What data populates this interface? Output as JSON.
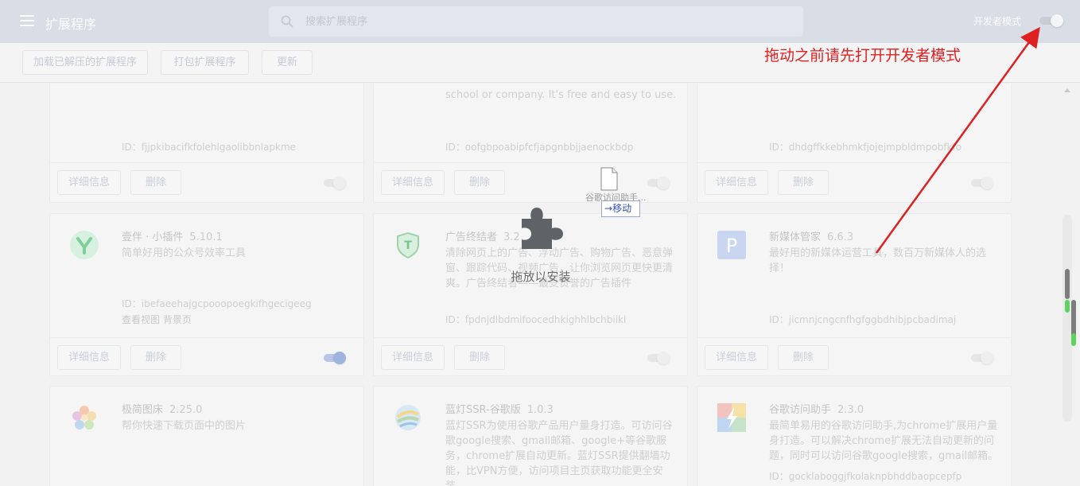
{
  "header": {
    "title": "扩展程序",
    "search_placeholder": "搜索扩展程序",
    "dev_mode_label": "开发者模式"
  },
  "toolbar": {
    "load_unpacked": "加载已解压的扩展程序",
    "pack": "打包扩展程序",
    "update": "更新"
  },
  "card_buttons": {
    "details": "详细信息",
    "remove": "删除"
  },
  "cards_top": [
    {
      "desc": "",
      "id": "ID：fjjpkibacifkfolehlgaolibbnlapkme"
    },
    {
      "desc": "school or company. It's free and easy to use.",
      "id": "ID：oofgbpoabipfcfjapgnbbjjaenockbdp"
    },
    {
      "desc": "",
      "id": "ID：dhdgffkkebhmkfjojejmpbldmpobfkfo"
    }
  ],
  "cards_mid": [
    {
      "name": "壹伴 · 小插件",
      "version": "5.10.1",
      "desc": "简单好用的公众号效率工具",
      "id": "ID：ibefaeehajgcpooopoegkifhgecigeeg",
      "views": "查看视图 背景页",
      "icon_color": "#7ecf9b",
      "enabled": true
    },
    {
      "name": "广告终结者",
      "version": "3.2",
      "desc": "清除网页上的广告、浮动广告、购物广告、恶意弹窗、跟踪代码、视频广告，让你浏览网页更快更清爽。广告终结者——最受赞誉的广告插件",
      "id": "ID：fpdnjdlbdmifoocedhkighhlbchbiikl",
      "views": "",
      "icon_color": "#7bc48d",
      "enabled": false
    },
    {
      "name": "新媒体管家",
      "version": "6.6.3",
      "desc": "最好用的新媒体运营工具，数百万新媒体人的选择！",
      "id": "ID：jicmnjcngcnfhgfggbdhibjpcbadimaj",
      "views": "",
      "icon_color": "#8ea6df",
      "enabled": false
    }
  ],
  "cards_bottom": [
    {
      "name": "极简图床",
      "version": "2.25.0",
      "desc": "帮你快速下载页面中的图片"
    },
    {
      "name": "蓝灯SSR-谷歌版",
      "version": "1.0.3",
      "desc": "蓝灯SSR为使用谷歌产品用户量身打造。可访问谷歌google搜索、gmail邮箱、google+等谷歌服务，chrome扩展自动更新。蓝灯SSR提供翻墙功能，比VPN方便，访问项目主页获取功能更全安装。"
    },
    {
      "name": "谷歌访问助手",
      "version": "2.3.0",
      "desc": "最简单易用的谷歌访问助手,为chrome扩展用户量身打造。可以解决chrome扩展无法自动更新的问题，同时可以访问谷歌google搜索，gmail邮箱。",
      "id": "ID：gocklaboggjfkolaknpbhddbaopcepfp"
    }
  ],
  "drop_zone": {
    "label": "拖放以安装"
  },
  "drag_tip": {
    "label": "移动",
    "ghost_text": "谷歌访问助手..."
  },
  "annotation": {
    "text": "拖动之前请先打开开发者模式",
    "color": "#e02020"
  },
  "icons": {
    "menu": "menu-icon",
    "search": "search-icon",
    "puzzle": "puzzle-icon",
    "file": "file-icon"
  }
}
